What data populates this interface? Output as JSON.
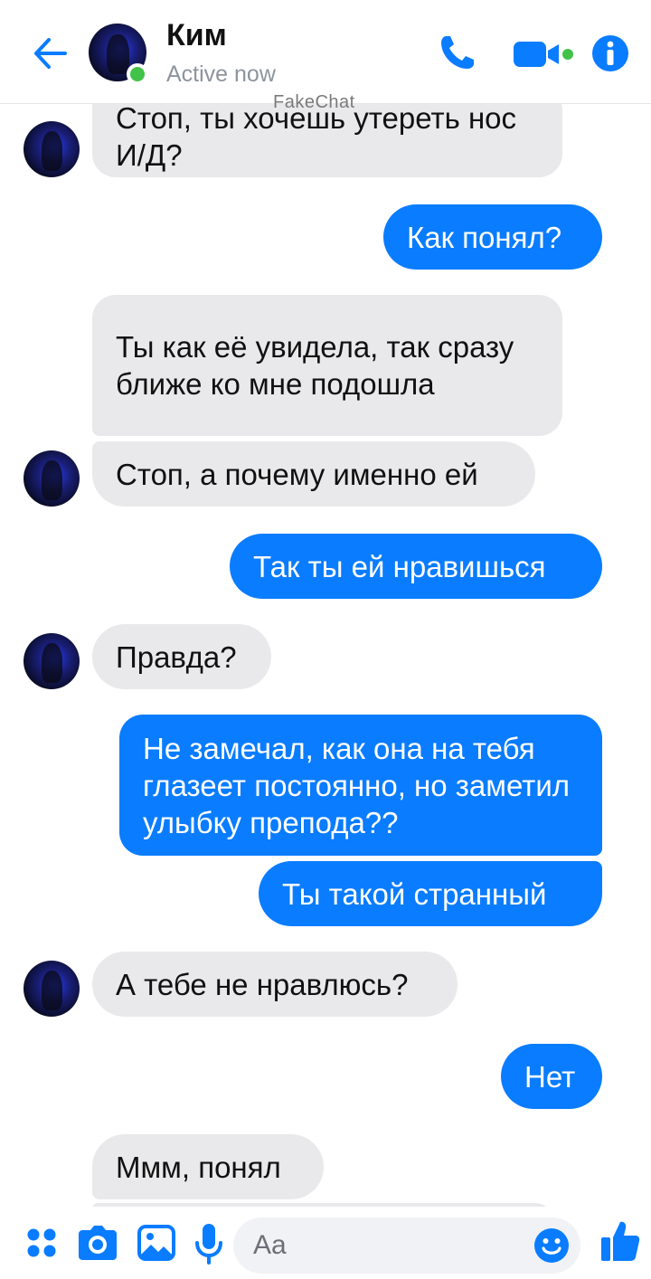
{
  "header": {
    "contact_name": "Ким",
    "status": "Active now",
    "watermark": "FakeChat",
    "icons": [
      "back-arrow-icon",
      "phone-icon",
      "video-camera-icon",
      "info-icon"
    ]
  },
  "messages": [
    {
      "sender": "contact",
      "text": "Стоп, ты хочешь утереть нос И/Д?"
    },
    {
      "sender": "me",
      "text": "Как понял?"
    },
    {
      "sender": "contact",
      "text": "Ты как её увидела, так сразу ближе ко мне подошла"
    },
    {
      "sender": "contact",
      "text": "Стоп, а почему именно ей"
    },
    {
      "sender": "me",
      "text": "Так ты ей нравишься"
    },
    {
      "sender": "contact",
      "text": "Правда?"
    },
    {
      "sender": "me",
      "text": "Не замечал, как она на тебя глазеет постоянно, но заметил улыбку препода??"
    },
    {
      "sender": "me",
      "text": "Ты такой странный"
    },
    {
      "sender": "contact",
      "text": "А тебе не нравлюсь?"
    },
    {
      "sender": "me",
      "text": "Нет"
    },
    {
      "sender": "contact",
      "text": "Ммм, понял"
    }
  ],
  "composer": {
    "placeholder": "Aa",
    "icons": [
      "apps-grid-icon",
      "camera-icon",
      "gallery-icon",
      "microphone-icon",
      "emoji-icon",
      "thumbs-up-icon"
    ]
  },
  "colors": {
    "accent": "#0a7cff",
    "incoming_bubble": "#e9e9eb",
    "online": "#41c248"
  }
}
